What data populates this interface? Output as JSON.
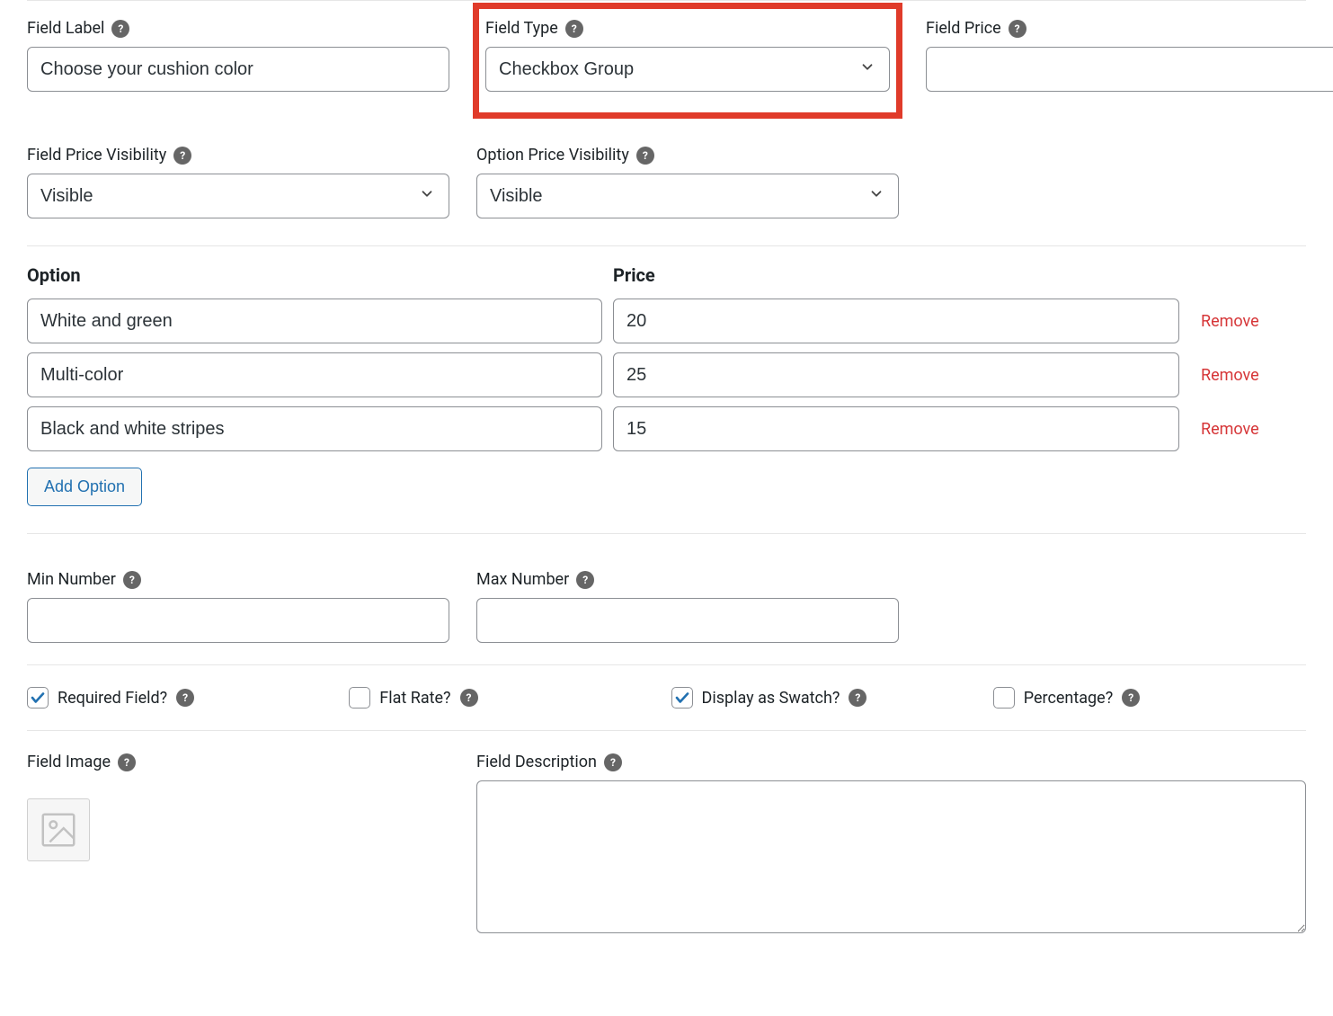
{
  "labels": {
    "field_label": "Field Label",
    "field_type": "Field Type",
    "field_price": "Field Price",
    "field_price_visibility": "Field Price Visibility",
    "option_price_visibility": "Option Price Visibility",
    "option": "Option",
    "price": "Price",
    "remove": "Remove",
    "add_option": "Add Option",
    "min_number": "Min Number",
    "max_number": "Max Number",
    "required_field": "Required Field?",
    "flat_rate": "Flat Rate?",
    "display_as_swatch": "Display as Swatch?",
    "percentage": "Percentage?",
    "field_image": "Field Image",
    "field_description": "Field Description"
  },
  "values": {
    "field_label": "Choose your cushion color",
    "field_type": "Checkbox Group",
    "field_price": "",
    "field_price_visibility": "Visible",
    "option_price_visibility": "Visible",
    "min_number": "",
    "max_number": "",
    "field_description": ""
  },
  "options": [
    {
      "name": "White and green",
      "price": "20"
    },
    {
      "name": "Multi-color",
      "price": "25"
    },
    {
      "name": "Black and white stripes",
      "price": "15"
    }
  ],
  "checks": {
    "required_field": true,
    "flat_rate": false,
    "display_as_swatch": true,
    "percentage": false
  }
}
